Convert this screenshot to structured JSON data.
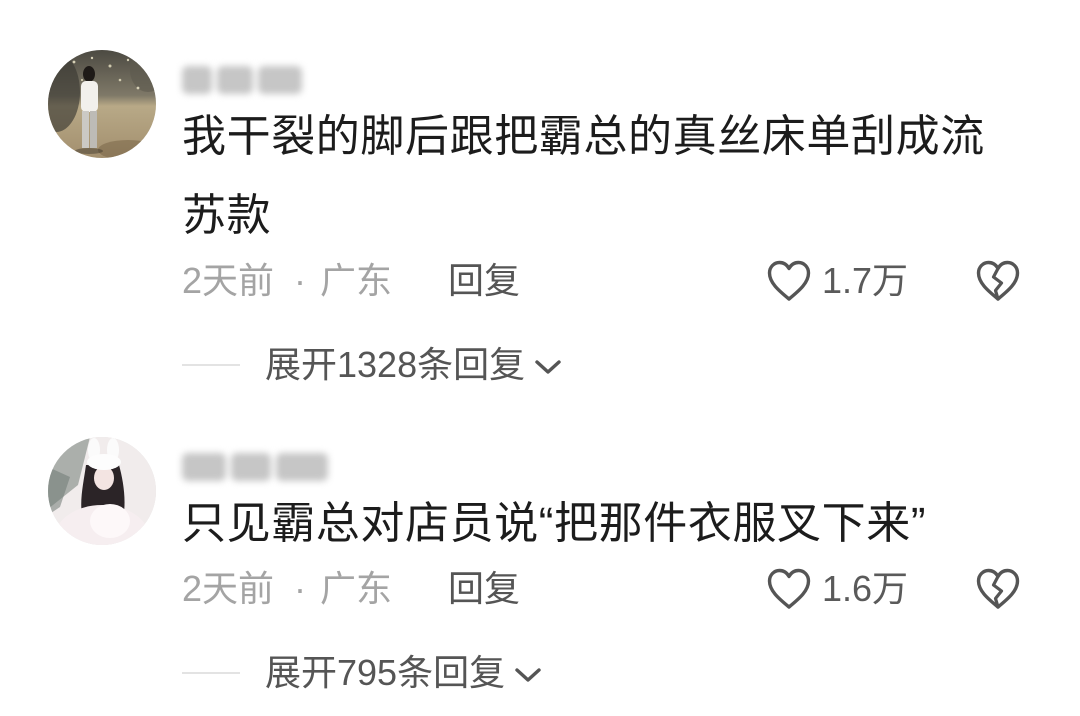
{
  "comments": [
    {
      "comment_text": "我干裂的脚后跟把霸总的真丝床单刮成流苏款",
      "time": "2天前",
      "separator": "·",
      "location": "广东",
      "reply_label": "回复",
      "like_count": "1.7万",
      "expand_replies_label": "展开1328条回复"
    },
    {
      "comment_text": "只见霸总对店员说“把那件衣服叉下来”",
      "time": "2天前",
      "separator": "·",
      "location": "广东",
      "reply_label": "回复",
      "like_count": "1.6万",
      "expand_replies_label": "展开795条回复"
    }
  ],
  "icons": {
    "like": "heart-outline-icon",
    "dislike": "broken-heart-icon",
    "expand": "chevron-down-icon"
  },
  "colors": {
    "background": "#ffffff",
    "comment_text": "#1c1c1c",
    "meta_text": "#a4a4a4",
    "action_text": "#555555",
    "divider": "#e3e3e3"
  }
}
